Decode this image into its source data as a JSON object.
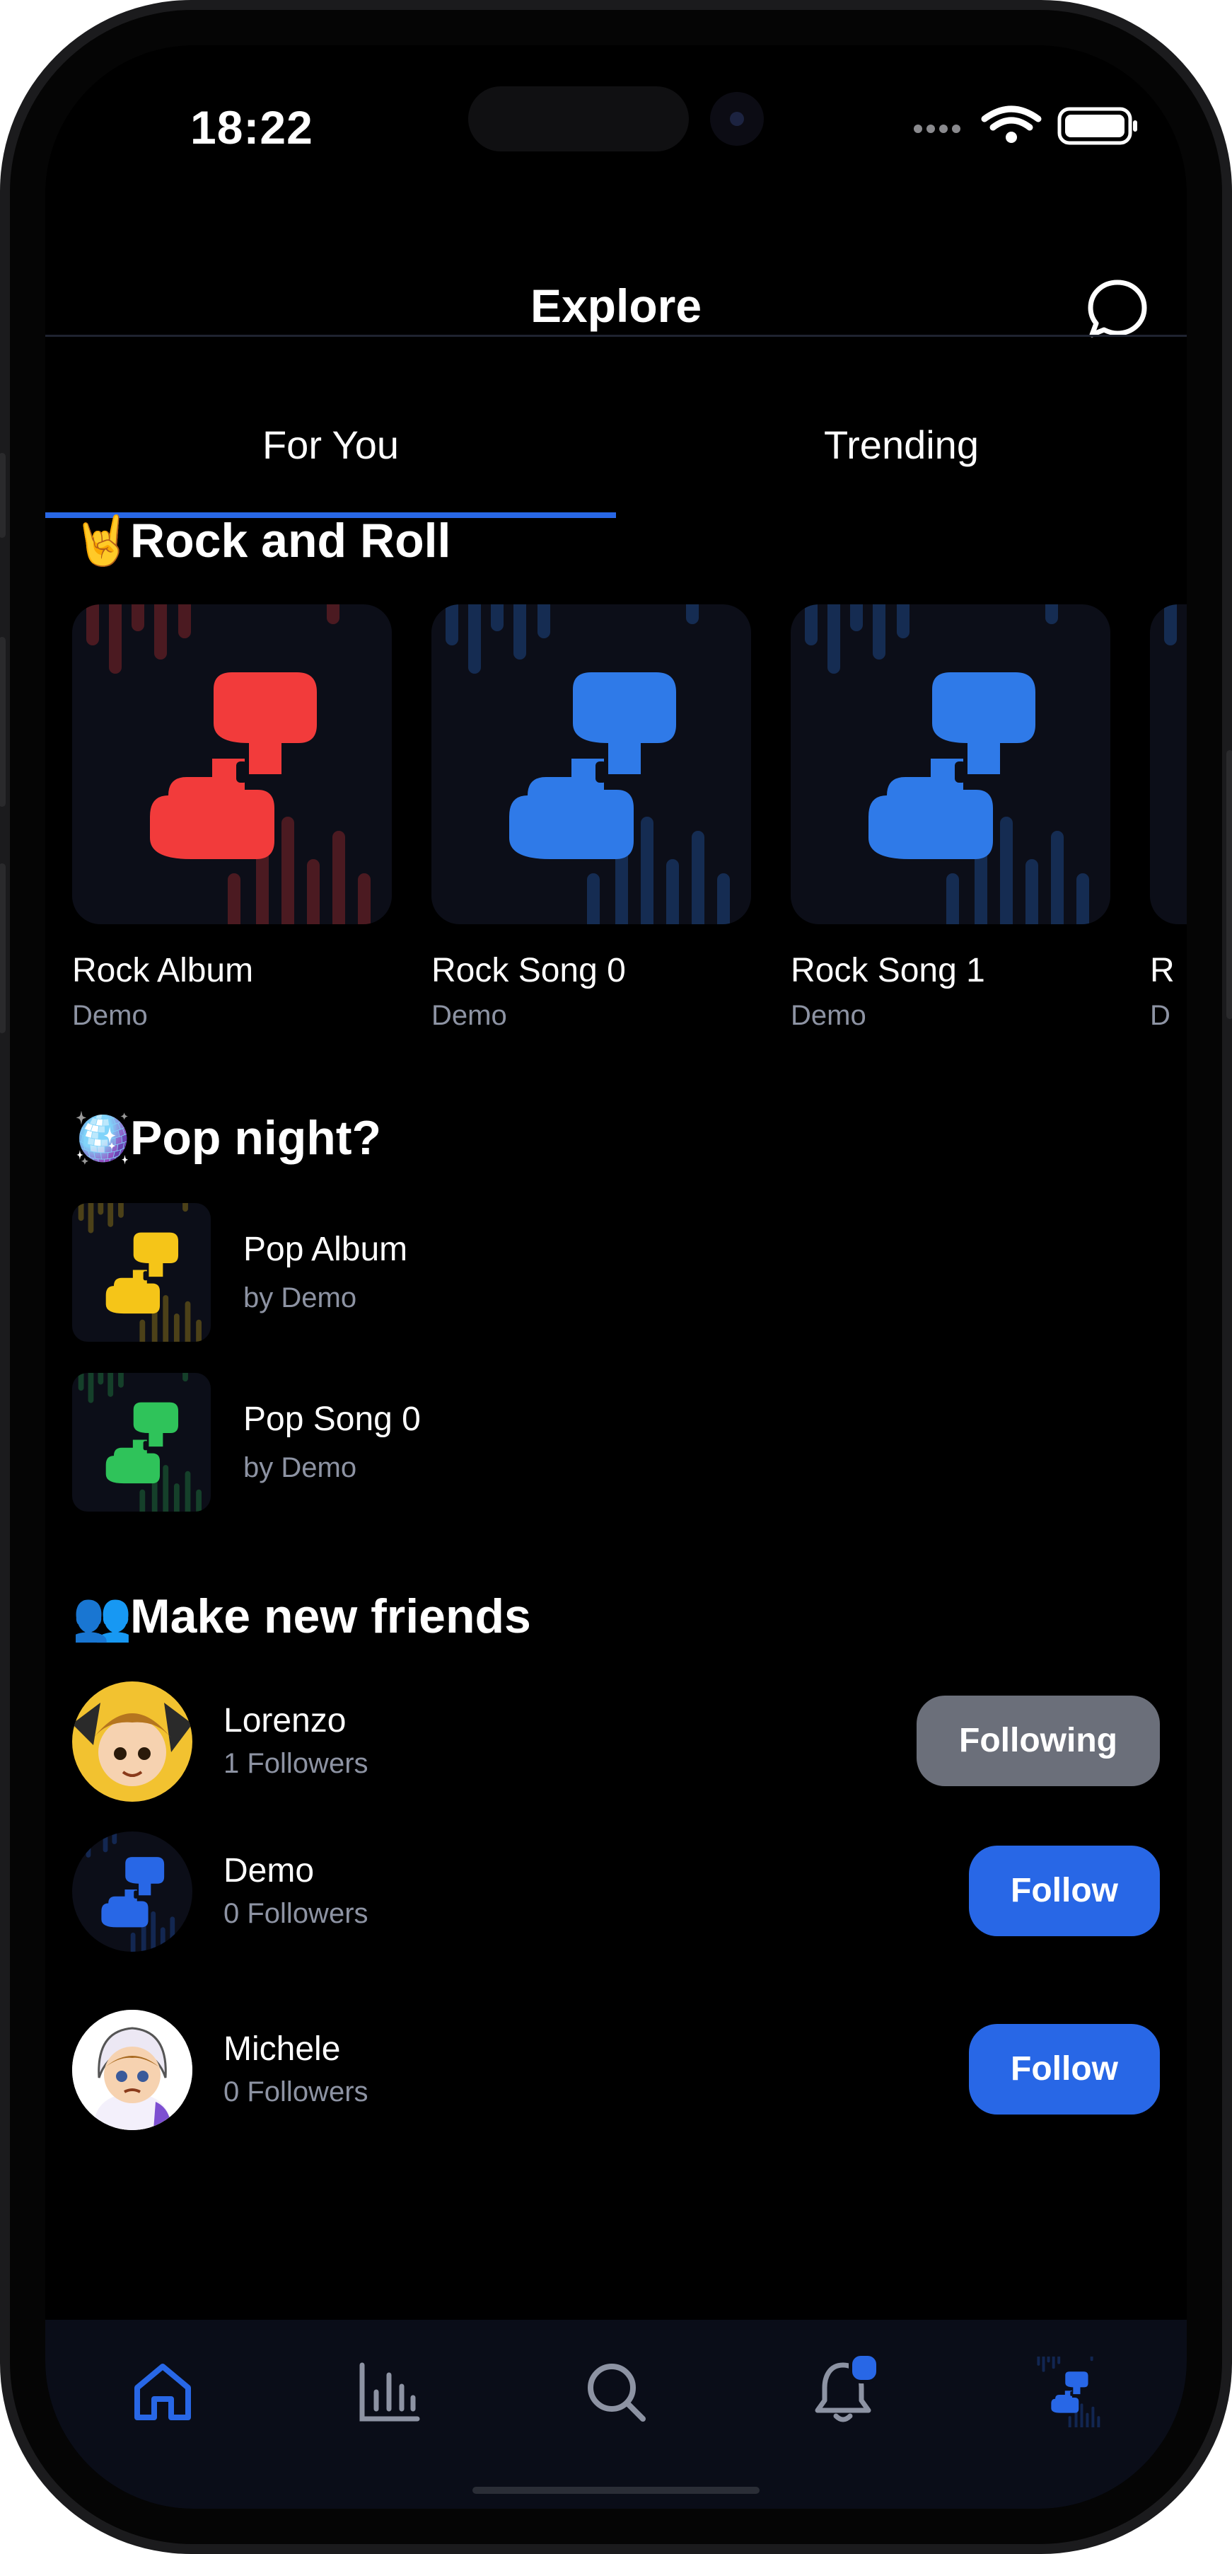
{
  "status_bar": {
    "time": "18:22"
  },
  "header": {
    "title": "Explore",
    "chat_icon": "chat-bubble-icon"
  },
  "tabs": [
    {
      "label": "For You",
      "active": true
    },
    {
      "label": "Trending",
      "active": false
    }
  ],
  "sections": {
    "rock": {
      "emoji": "🤘",
      "title": "Rock and Roll",
      "items": [
        {
          "title": "Rock Album",
          "subtitle": "Demo",
          "color": "#f23b3b"
        },
        {
          "title": "Rock Song 0",
          "subtitle": "Demo",
          "color": "#2f7ae8"
        },
        {
          "title": "Rock Song 1",
          "subtitle": "Demo",
          "color": "#2f7ae8"
        },
        {
          "title": "R",
          "subtitle": "D",
          "color": "#2f7ae8"
        }
      ]
    },
    "pop": {
      "emoji": "🪩",
      "title": "Pop night?",
      "items": [
        {
          "title": "Pop Album",
          "subtitle": "by Demo",
          "color": "#f5c518"
        },
        {
          "title": "Pop Song 0",
          "subtitle": "by Demo",
          "color": "#2fc35a"
        }
      ]
    },
    "friends": {
      "emoji": "👥",
      "title": "Make new friends",
      "people": [
        {
          "name": "Lorenzo",
          "followers": "1 Followers",
          "button": "Following"
        },
        {
          "name": "Demo",
          "followers": "0 Followers",
          "button": "Follow"
        },
        {
          "name": "Michele",
          "followers": "0 Followers",
          "button": "Follow"
        }
      ]
    }
  },
  "tab_bar": {
    "items": [
      "home-icon",
      "stats-icon",
      "search-icon",
      "bell-icon",
      "profile-logo-icon"
    ],
    "active": "home-icon"
  },
  "colors": {
    "accent": "#2867e6",
    "background": "#000000",
    "tabbar": "#0a0d18",
    "secondary_text": "#8d93a3",
    "following_button": "#6b6f7a"
  }
}
